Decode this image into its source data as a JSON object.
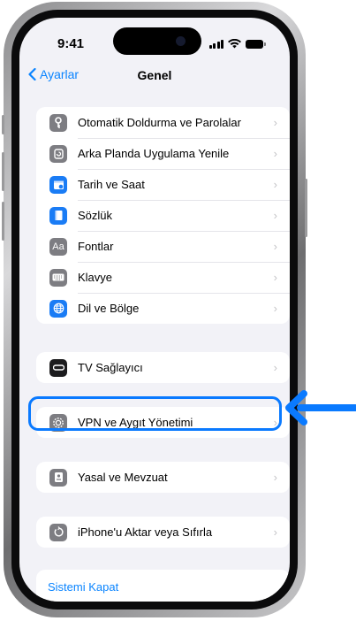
{
  "status_bar": {
    "time": "9:41"
  },
  "nav": {
    "back_label": "Ayarlar",
    "title": "Genel"
  },
  "groups": [
    [
      {
        "label": "Otomatik Doldurma ve Parolalar",
        "icon": "key-icon",
        "color": "#7d7d82"
      },
      {
        "label": "Arka Planda Uygulama Yenile",
        "icon": "refresh-icon",
        "color": "#7d7d82"
      },
      {
        "label": "Tarih ve Saat",
        "icon": "calendar-clock-icon",
        "color": "#1a7cf5"
      },
      {
        "label": "Sözlük",
        "icon": "book-icon",
        "color": "#1a7cf5"
      },
      {
        "label": "Fontlar",
        "icon": "fonts-icon",
        "color": "#7d7d82"
      },
      {
        "label": "Klavye",
        "icon": "keyboard-icon",
        "color": "#7d7d82"
      },
      {
        "label": "Dil ve Bölge",
        "icon": "globe-icon",
        "color": "#1a7cf5"
      }
    ],
    [
      {
        "label": "TV Sağlayıcı",
        "icon": "tv-provider-icon",
        "color": "#1c1c1e"
      }
    ],
    [
      {
        "label": "VPN ve Aygıt Yönetimi",
        "icon": "gear-icon",
        "color": "#7d7d82"
      }
    ],
    [
      {
        "label": "Yasal ve Mevzuat",
        "icon": "document-icon",
        "color": "#7d7d82"
      }
    ],
    [
      {
        "label": "iPhone'u Aktar veya Sıfırla",
        "icon": "reset-icon",
        "color": "#7d7d82"
      }
    ]
  ],
  "shutdown_label": "Sistemi Kapat",
  "colors": {
    "accent": "#0a84ff",
    "highlight": "#0a7aff"
  }
}
